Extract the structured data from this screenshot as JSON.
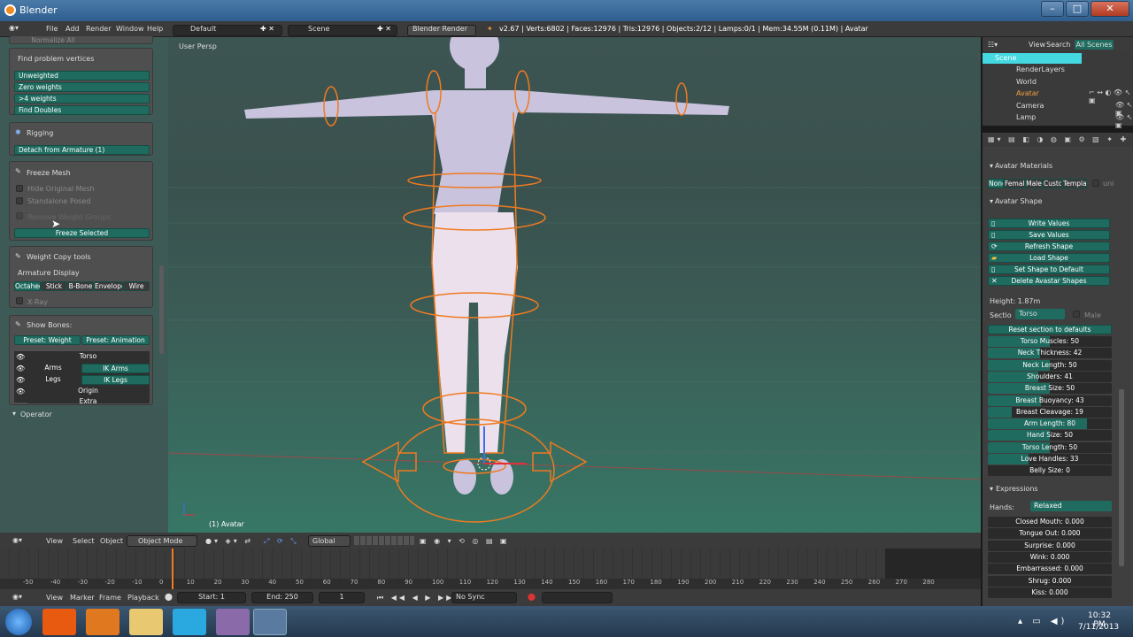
{
  "window": {
    "title": "Blender",
    "min": "–",
    "max": "□",
    "close": "✕"
  },
  "info": {
    "menus": [
      "File",
      "Add",
      "Render",
      "Window",
      "Help"
    ],
    "screen": "Default",
    "scene": "Scene",
    "engine": "Blender Render",
    "stats": "v2.67 | Verts:6802 | Faces:12976 | Tris:12976 | Objects:2/12 | Lamps:0/1 | Mem:34.55M (0.11M) | Avatar"
  },
  "tools": {
    "top_label": "Normalize All",
    "find_label": "Find problem vertices",
    "find_buttons": [
      "Unweighted",
      "Zero weights",
      ">4 weights",
      "Find Doubles"
    ],
    "rigging": "Rigging",
    "detach": "Detach from Armature (1)",
    "freeze": "Freeze Mesh",
    "freeze_opts": [
      "Hide Original Mesh",
      "Standalone Posed",
      "Remove Weight Groups"
    ],
    "freeze_btn": "Freeze Selected",
    "wcopy": "Weight Copy tools",
    "arm_display": "Armature Display",
    "arm_modes": [
      "Octahed",
      "Stick",
      "B-Bone",
      "Envelope",
      "Wire"
    ],
    "xray": "X-Ray",
    "show_bones": "Show Bones:",
    "presets": [
      "Preset: Weight",
      "Preset: Animation"
    ],
    "bones": [
      "Torso",
      "Arms",
      "IK Arms",
      "Legs",
      "IK Legs",
      "Origin",
      "Extra"
    ],
    "operator": "Operator"
  },
  "viewport": {
    "label": "User Persp",
    "object": "(1) Avatar"
  },
  "outliner": {
    "menus": [
      "View",
      "Search",
      "All Scenes"
    ],
    "items": [
      "Scene",
      "RenderLayers",
      "World",
      "Avatar",
      "Camera",
      "Lamp"
    ]
  },
  "props": {
    "materials": "Avatar Materials",
    "mat_opts": [
      "None",
      "Femal",
      "Male",
      "Custo",
      "Templa",
      "uni"
    ],
    "shape": "Avatar Shape",
    "shape_btns": [
      "Write Values",
      "Save Values",
      "Refresh Shape",
      "Load Shape",
      "Set Shape to Default",
      "Delete Avastar Shapes"
    ],
    "height": "Height: 1.87m",
    "section_label": "Sectio",
    "section": "Torso",
    "male": "Male",
    "reset": "Reset section to defaults",
    "sliders": [
      {
        "label": "Torso Muscles: 50",
        "value": 50
      },
      {
        "label": "Neck Thickness: 42",
        "value": 42
      },
      {
        "label": "Neck Length: 50",
        "value": 50
      },
      {
        "label": "Shoulders: 41",
        "value": 41
      },
      {
        "label": "Breast Size: 50",
        "value": 50
      },
      {
        "label": "Breast Buoyancy: 43",
        "value": 43
      },
      {
        "label": "Breast Cleavage: 19",
        "value": 19
      },
      {
        "label": "Arm Length: 80",
        "value": 80
      },
      {
        "label": "Hand Size: 50",
        "value": 50
      },
      {
        "label": "Torso Length: 50",
        "value": 50
      },
      {
        "label": "Love Handles: 33",
        "value": 33
      },
      {
        "label": "Belly Size: 0",
        "value": 0
      }
    ],
    "expressions": "Expressions",
    "hands_label": "Hands:",
    "hands": "Relaxed",
    "expr": [
      {
        "label": "Closed Mouth: 0.000",
        "value": 0
      },
      {
        "label": "Tongue Out: 0.000",
        "value": 0
      },
      {
        "label": "Surprise: 0.000",
        "value": 0
      },
      {
        "label": "Wink: 0.000",
        "value": 0
      },
      {
        "label": "Embarrassed: 0.000",
        "value": 0
      },
      {
        "label": "Shrug: 0.000",
        "value": 0
      },
      {
        "label": "Kiss: 0.000",
        "value": 0
      }
    ]
  },
  "vheader": {
    "menus": [
      "View",
      "Select",
      "Object"
    ],
    "mode": "Object Mode",
    "orient": "Global"
  },
  "timeline": {
    "ticks": [
      "-50",
      "-40",
      "-30",
      "-20",
      "-10",
      "0",
      "10",
      "20",
      "30",
      "40",
      "50",
      "60",
      "70",
      "80",
      "90",
      "100",
      "110",
      "120",
      "130",
      "140",
      "150",
      "160",
      "170",
      "180",
      "190",
      "200",
      "210",
      "220",
      "230",
      "240",
      "250",
      "260",
      "270",
      "280"
    ],
    "menus": [
      "View",
      "Marker",
      "Frame",
      "Playback"
    ],
    "start": "Start: 1",
    "end": "End: 250",
    "frame": "1",
    "sync": "No Sync"
  },
  "clock": {
    "time": "10:32 PM",
    "date": "7/11/2013"
  }
}
